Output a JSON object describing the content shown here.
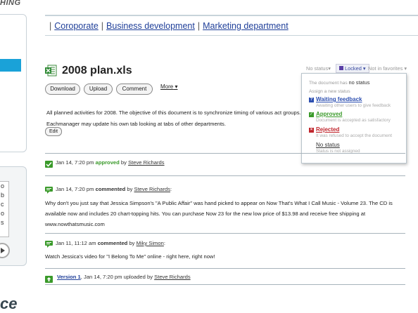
{
  "app": {
    "brand_fragment": "HING",
    "logo_fragment": "ce"
  },
  "left_panel": {
    "lines": [
      "o",
      "b",
      "c",
      "o",
      "s"
    ]
  },
  "breadcrumbs": [
    {
      "label": "Coroporate"
    },
    {
      "label": "Business development"
    },
    {
      "label": "Marketing department"
    }
  ],
  "document": {
    "title": "2008 plan.xls",
    "buttons": {
      "download": "Download",
      "upload": "Upload",
      "comment": "Comment",
      "more": "More"
    },
    "description": "All planned activities for 2008. The objective of this document is to synchronize timing of various act groups. Eachmanager may update his own tab looking at tabs of other departments.",
    "edit_label": "Edit"
  },
  "status_bar": {
    "status": "No status",
    "locked": "Locked",
    "favorites": "Not in favorites"
  },
  "status_popup": {
    "current_prefix": "The document has",
    "current_value": "no status",
    "assign_label": "Assign a new status",
    "options": [
      {
        "label": "Waiting feedback",
        "desc": "Awaiting other users to give feedback",
        "color": "#2d4fb0"
      },
      {
        "label": "Approved",
        "desc": "Document is accepted as satisfactory",
        "color": "#3a9a2a"
      },
      {
        "label": "Rejected",
        "desc": "It was refused to accept the document",
        "color": "#c0262d"
      },
      {
        "label": "No status",
        "desc": "Status is not assigned",
        "color": "#333333"
      }
    ]
  },
  "activity": [
    {
      "date": "Jan 14, 7:20 pm",
      "action": "approved",
      "by": "by",
      "user": "Steve Richards"
    },
    {
      "date": "Jan 14, 7:20 pm",
      "action": "commented",
      "by": "by",
      "user": "Steve Richards",
      "body": "Why don't you just say that Jessica Simpson's \"A Public Affair\" was hand picked to appear on Now That's What I Call Music - Volume 23. The CD is available now and includes 20 chart-topping hits. You can purchase Now 23 for the new low price of $13.98 and receive free shipping at www.nowthatsmusic.com"
    },
    {
      "date": "Jan 11, 11:12 am",
      "action": "commented",
      "by": "by",
      "user": "Miky Simon",
      "body": "Watch Jessica's video for \"I Belong To Me\" online - right here, right now!"
    },
    {
      "date": "Jan 14, 7:20 pm",
      "version": "Version 1",
      "action": "uploaded",
      "by": "by",
      "user": "Steve Richards"
    }
  ]
}
